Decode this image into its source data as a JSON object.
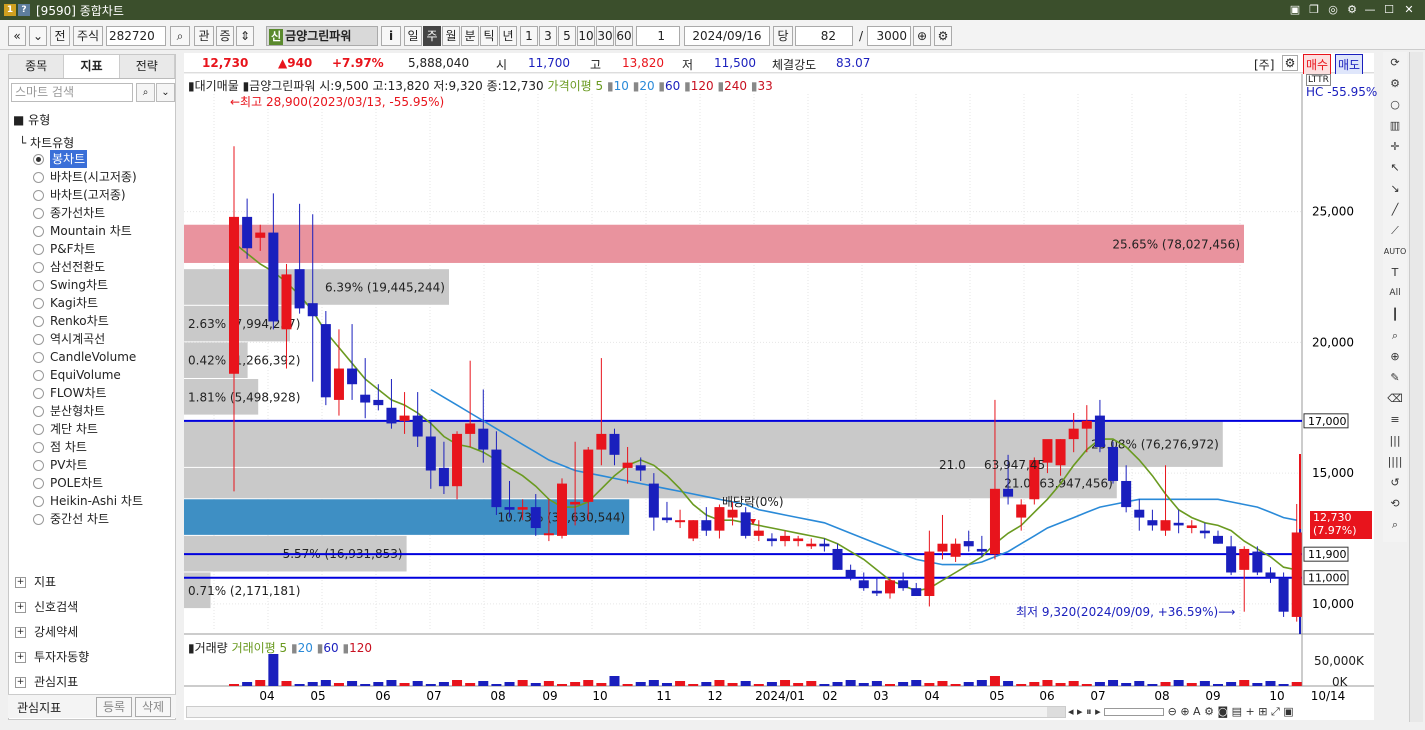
{
  "window": {
    "title": "[9590] 종합차트",
    "badges": [
      "1",
      "?"
    ]
  },
  "toolbar": {
    "nav_prev": "«",
    "nav_down": "⌄",
    "prev_label": "전",
    "market": "주식",
    "code": "282720",
    "search_icon": "⌕",
    "gwan": "관",
    "jeung": "증",
    "sin": "신",
    "stock_name": "금양그린파워",
    "info": "i",
    "periods": [
      "일",
      "주",
      "월",
      "분",
      "틱",
      "년"
    ],
    "minutes": [
      "1",
      "3",
      "5",
      "10",
      "30",
      "60"
    ],
    "page": "1",
    "date": "2024/09/16",
    "dang": "당",
    "count": "82",
    "slash": "/",
    "total": "3000"
  },
  "left_panel": {
    "tabs": [
      "종목",
      "지표",
      "전략"
    ],
    "search_placeholder": "스마트 검색",
    "tree_head": "유형",
    "sub_head": "차트유형",
    "chart_types": [
      "봉차트",
      "바차트(시고저종)",
      "바차트(고저종)",
      "종가선차트",
      "Mountain 차트",
      "P&F차트",
      "삼선전환도",
      "Swing차트",
      "Kagi차트",
      "Renko차트",
      "역시계곡선",
      "CandleVolume",
      "EquiVolume",
      "FLOW차트",
      "분산형차트",
      "계단 차트",
      "점 차트",
      "PV차트",
      "POLE차트",
      "Heikin-Ashi 차트",
      "중간선 차트"
    ],
    "folders": [
      "지표",
      "신호검색",
      "강세약세",
      "투자자동향",
      "관심지표"
    ],
    "bottom_label": "관심지표",
    "register": "등록",
    "delete": "삭제"
  },
  "infobar": {
    "price": "12,730",
    "change": "▲940",
    "rate": "+7.97%",
    "volume": "5,888,040",
    "open_label": "시",
    "open": "11,700",
    "high_label": "고",
    "high": "13,820",
    "low_label": "저",
    "low": "11,500",
    "strength_label": "체결강도",
    "strength": "83.07",
    "bracket": "[주]",
    "buy": "매수",
    "sell": "매도"
  },
  "chart_header": {
    "text": "▮대기매물 ▮금양그린파워 시:9,500 고:13,820 저:9,320 종:12,730",
    "ma_label": "가격이평 5",
    "ma_periods": [
      "10",
      "20",
      "60",
      "120",
      "240",
      "33"
    ],
    "hc": "HC -55.95%",
    "lt": "LTTR"
  },
  "annotations": {
    "high": "←최고 28,900(2023/03/13, -55.95%)",
    "low": "최저 9,320(2024/09/09, +36.59%)⟶",
    "dividend": "배당락(0%)",
    "mid_label": "21.0",
    "mid_label2": "63,947,45"
  },
  "volume_header": {
    "label": "▮거래량",
    "ma_label": "거래이평 5",
    "periods": [
      "20",
      "60",
      "120"
    ],
    "y_labels": [
      "50,000K",
      "0K"
    ]
  },
  "x_labels": [
    "04",
    "05",
    "06",
    "07",
    "08",
    "09",
    "10",
    "11",
    "12",
    "2024/01",
    "02",
    "03",
    "04",
    "05",
    "06",
    "07",
    "08",
    "09",
    "10",
    "10/14"
  ],
  "colors": {
    "up": "#e8141c",
    "down": "#1a1fbd",
    "ma5": "#6a9a20",
    "ma20": "#2a8ad8",
    "ma60": "#c81020",
    "line": "#0000dd"
  },
  "chart_data": {
    "type": "candlestick",
    "ylim": [
      9000,
      29500
    ],
    "y_ticks": [
      10000,
      15000,
      20000,
      25000
    ],
    "y_tick_labels": [
      "10,000",
      "15,000",
      "20,000",
      "25,000"
    ],
    "price_lines": [
      17000,
      11900,
      11000
    ],
    "price_line_labels": [
      "17,000",
      "11,900",
      "11,000"
    ],
    "current_price": "12,730",
    "current_price_sub": "(7.97%)",
    "volume_profile": [
      {
        "low": 23000,
        "high": 24500,
        "label": "25.65% (78,027,456)",
        "color": "#e9939e",
        "width": 1.0
      },
      {
        "low": 21400,
        "high": 22800,
        "label": "6.39% (19,445,244)",
        "color": "#c9c9c9",
        "width": 0.25
      },
      {
        "low": 20000,
        "high": 21400,
        "label": "2.63% (7,994,237)",
        "color": "#c9c9c9",
        "width": 0.1
      },
      {
        "low": 18600,
        "high": 20000,
        "label": "0.42% (1,266,392)",
        "color": "#c9c9c9",
        "width": 0.06
      },
      {
        "low": 17200,
        "high": 18600,
        "label": "1.81% (5,498,928)",
        "color": "#c9c9c9",
        "width": 0.07
      },
      {
        "low": 15200,
        "high": 17000,
        "label": "25.08% (76,276,972)",
        "color": "#c9c9c9",
        "width": 0.98
      },
      {
        "low": 14000,
        "high": 15200,
        "label": "21.0 (63,947,456)",
        "color": "#c9c9c9",
        "width": 0.88
      },
      {
        "low": 12600,
        "high": 14000,
        "label": "10.73% (32,630,544)",
        "color": "#3e8fc4",
        "width": 0.42
      },
      {
        "low": 11200,
        "high": 12600,
        "label": "5.57% (16,931,853)",
        "color": "#c9c9c9",
        "width": 0.21
      },
      {
        "low": 9800,
        "high": 11200,
        "label": "0.71% (2,171,181)",
        "color": "#c9c9c9",
        "width": 0.025
      }
    ],
    "candles": [
      [
        18800,
        27500,
        14300,
        24800
      ],
      [
        24800,
        25500,
        23200,
        23600
      ],
      [
        24000,
        24500,
        23500,
        24200
      ],
      [
        24200,
        25700,
        20500,
        20800
      ],
      [
        20500,
        23000,
        19000,
        22600
      ],
      [
        22800,
        25300,
        21100,
        21300
      ],
      [
        21500,
        24900,
        18500,
        21000
      ],
      [
        20700,
        21200,
        17600,
        17900
      ],
      [
        17800,
        20500,
        17200,
        19000
      ],
      [
        19000,
        20700,
        17800,
        18400
      ],
      [
        18000,
        19400,
        17100,
        17700
      ],
      [
        17800,
        18400,
        17400,
        17600
      ],
      [
        17500,
        18600,
        16700,
        16900
      ],
      [
        17000,
        18100,
        16500,
        17200
      ],
      [
        17200,
        18100,
        16000,
        16400
      ],
      [
        16400,
        17000,
        14400,
        15100
      ],
      [
        15200,
        16200,
        14200,
        14500
      ],
      [
        14500,
        16600,
        14000,
        16500
      ],
      [
        16500,
        19300,
        16000,
        16900
      ],
      [
        16700,
        18200,
        15400,
        15900
      ],
      [
        15900,
        16600,
        13400,
        13700
      ],
      [
        13700,
        14700,
        13300,
        13600
      ],
      [
        13600,
        14000,
        13200,
        13700
      ],
      [
        13700,
        14200,
        12600,
        12900
      ],
      [
        12700,
        14000,
        12400,
        12700
      ],
      [
        12600,
        14800,
        12500,
        14600
      ],
      [
        13800,
        16200,
        13000,
        13900
      ],
      [
        13900,
        16000,
        13200,
        15900
      ],
      [
        15900,
        19400,
        15300,
        16500
      ],
      [
        16500,
        16700,
        15300,
        15700
      ],
      [
        15200,
        16000,
        14600,
        15400
      ],
      [
        15300,
        15600,
        14700,
        15100
      ],
      [
        14600,
        15000,
        12800,
        13300
      ],
      [
        13300,
        13900,
        13100,
        13200
      ],
      [
        13200,
        13600,
        12900,
        13200
      ],
      [
        12500,
        13200,
        12400,
        13200
      ],
      [
        13200,
        13700,
        12600,
        12800
      ],
      [
        12800,
        13800,
        12500,
        13700
      ],
      [
        13300,
        13900,
        13000,
        13600
      ],
      [
        13500,
        13700,
        12500,
        12600
      ],
      [
        12600,
        13200,
        12400,
        12800
      ],
      [
        12500,
        12700,
        12200,
        12400
      ],
      [
        12400,
        12800,
        12200,
        12600
      ],
      [
        12400,
        12600,
        12200,
        12500
      ],
      [
        12200,
        12500,
        12100,
        12300
      ],
      [
        12300,
        12500,
        12000,
        12200
      ],
      [
        12100,
        12300,
        11300,
        11300
      ],
      [
        11300,
        11500,
        10900,
        11000
      ],
      [
        10900,
        11200,
        10500,
        10600
      ],
      [
        10500,
        11000,
        10300,
        10400
      ],
      [
        10400,
        11000,
        10200,
        10900
      ],
      [
        10900,
        11200,
        10500,
        10600
      ],
      [
        10600,
        10800,
        10300,
        10300
      ],
      [
        10300,
        12800,
        9900,
        12000
      ],
      [
        12000,
        13400,
        11700,
        12300
      ],
      [
        11800,
        12500,
        11600,
        12300
      ],
      [
        12400,
        12800,
        12000,
        12200
      ],
      [
        12100,
        12600,
        11800,
        12000
      ],
      [
        11900,
        17800,
        11700,
        14400
      ],
      [
        14400,
        15700,
        13800,
        14100
      ],
      [
        13300,
        14000,
        12800,
        13800
      ],
      [
        14000,
        15600,
        13800,
        15500
      ],
      [
        15400,
        16200,
        15000,
        16300
      ],
      [
        15300,
        16300,
        14900,
        16300
      ],
      [
        16300,
        17300,
        15800,
        16700
      ],
      [
        16700,
        17600,
        15800,
        17000
      ],
      [
        17200,
        17800,
        15800,
        16000
      ],
      [
        16000,
        16200,
        14600,
        14700
      ],
      [
        14700,
        15300,
        13500,
        13700
      ],
      [
        13600,
        14000,
        12800,
        13300
      ],
      [
        13200,
        13600,
        12800,
        13000
      ],
      [
        12800,
        15300,
        12600,
        13200
      ],
      [
        13100,
        13600,
        12700,
        13000
      ],
      [
        12900,
        13200,
        12700,
        13000
      ],
      [
        12800,
        13100,
        12500,
        12700
      ],
      [
        12600,
        12800,
        12300,
        12300
      ],
      [
        12200,
        12600,
        11100,
        11200
      ],
      [
        11300,
        12200,
        9700,
        12100
      ],
      [
        12000,
        12200,
        11100,
        11200
      ],
      [
        11200,
        11400,
        10800,
        11000
      ],
      [
        11000,
        11200,
        9500,
        9700
      ],
      [
        9500,
        13820,
        9320,
        12730
      ]
    ],
    "ma5": [
      23800,
      23400,
      23000,
      22700,
      22300,
      21800,
      21200,
      20400,
      19800,
      19200,
      18600,
      18200,
      17800,
      17600,
      17300,
      16900,
      16400,
      16100,
      16000,
      15800,
      15500,
      15200,
      14900,
      14500,
      14000,
      13700,
      13700,
      13900,
      14400,
      14900,
      15300,
      15500,
      15300,
      14900,
      14400,
      13800,
      13400,
      13200,
      13200,
      13100,
      13000,
      12900,
      12800,
      12700,
      12600,
      12500,
      12300,
      12000,
      11700,
      11300,
      10900,
      10700,
      10500,
      10600,
      10900,
      11200,
      11500,
      11800,
      12300,
      12700,
      13000,
      13500,
      14000,
      14600,
      15300,
      15900,
      16300,
      16300,
      16000,
      15500,
      14900,
      14200,
      13600,
      13300,
      13100,
      13000,
      12800,
      12400,
      12100,
      11800,
      11400,
      11300
    ],
    "ma20": [
      null,
      null,
      null,
      null,
      null,
      null,
      null,
      null,
      null,
      null,
      null,
      null,
      null,
      null,
      null,
      18200,
      17900,
      17600,
      17300,
      17000,
      16700,
      16400,
      16100,
      15800,
      15500,
      15300,
      15100,
      15000,
      14900,
      14800,
      14700,
      14600,
      14500,
      14400,
      14300,
      14200,
      14100,
      14000,
      13900,
      13800,
      13600,
      13500,
      13400,
      13300,
      13200,
      13100,
      12900,
      12700,
      12500,
      12300,
      12100,
      11900,
      11700,
      11600,
      11500,
      11500,
      11500,
      11600,
      11800,
      12000,
      12300,
      12600,
      12900,
      13100,
      13300,
      13500,
      13700,
      13800,
      13900,
      14000,
      14000,
      14000,
      14000,
      14000,
      14000,
      14000,
      13900,
      13800,
      13700,
      13500,
      13300,
      13200
    ]
  }
}
